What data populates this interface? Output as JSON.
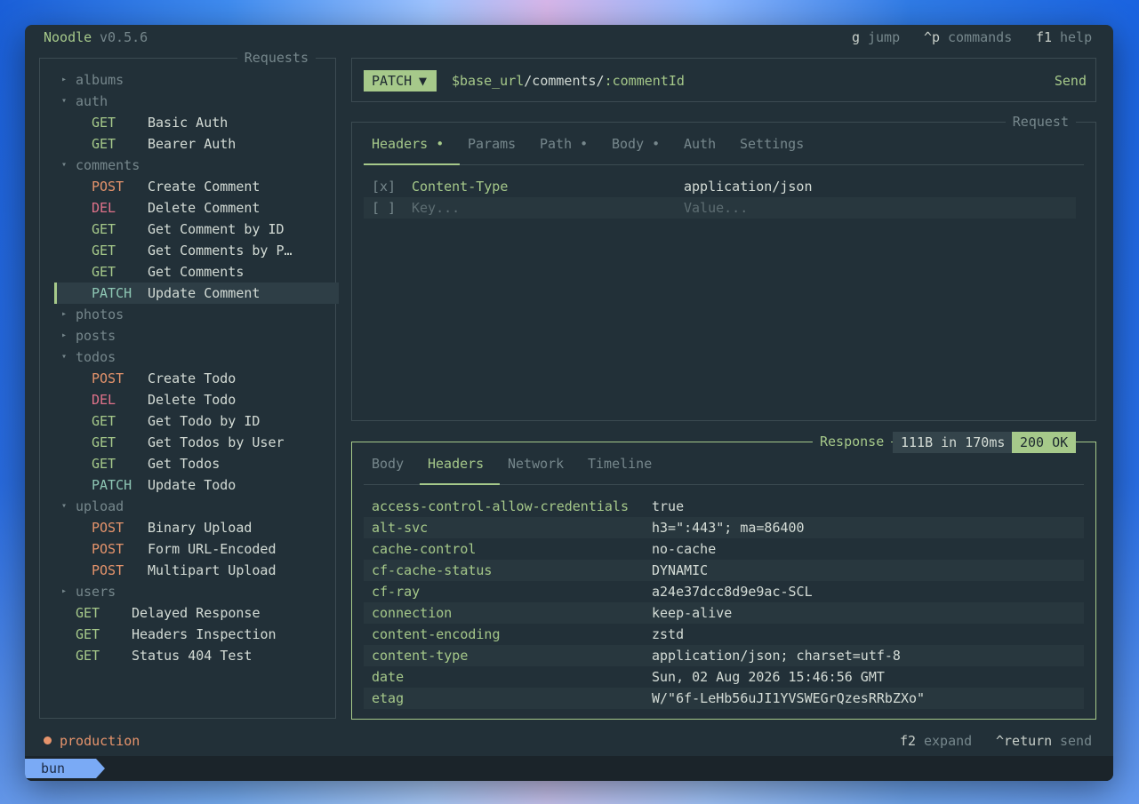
{
  "app": {
    "name": "Noodle",
    "version": "v0.5.6"
  },
  "shortcuts": [
    {
      "key": "g",
      "label": "jump"
    },
    {
      "key": "^p",
      "label": "commands"
    },
    {
      "key": "f1",
      "label": "help"
    }
  ],
  "sidebar": {
    "title": "Requests",
    "items": [
      {
        "type": "folder",
        "open": false,
        "name": "albums",
        "indent": 0
      },
      {
        "type": "folder",
        "open": true,
        "name": "auth",
        "indent": 0
      },
      {
        "type": "request",
        "method": "GET",
        "name": "Basic Auth",
        "indent": 1
      },
      {
        "type": "request",
        "method": "GET",
        "name": "Bearer Auth",
        "indent": 1
      },
      {
        "type": "folder",
        "open": true,
        "name": "comments",
        "indent": 0
      },
      {
        "type": "request",
        "method": "POST",
        "name": "Create Comment",
        "indent": 1
      },
      {
        "type": "request",
        "method": "DEL",
        "name": "Delete Comment",
        "indent": 1
      },
      {
        "type": "request",
        "method": "GET",
        "name": "Get Comment by ID",
        "indent": 1
      },
      {
        "type": "request",
        "method": "GET",
        "name": "Get Comments by P…",
        "indent": 1
      },
      {
        "type": "request",
        "method": "GET",
        "name": "Get Comments",
        "indent": 1
      },
      {
        "type": "request",
        "method": "PATCH",
        "name": "Update Comment",
        "indent": 1,
        "selected": true
      },
      {
        "type": "folder",
        "open": false,
        "name": "photos",
        "indent": 0
      },
      {
        "type": "folder",
        "open": false,
        "name": "posts",
        "indent": 0
      },
      {
        "type": "folder",
        "open": true,
        "name": "todos",
        "indent": 0
      },
      {
        "type": "request",
        "method": "POST",
        "name": "Create Todo",
        "indent": 1
      },
      {
        "type": "request",
        "method": "DEL",
        "name": "Delete Todo",
        "indent": 1
      },
      {
        "type": "request",
        "method": "GET",
        "name": "Get Todo by ID",
        "indent": 1
      },
      {
        "type": "request",
        "method": "GET",
        "name": "Get Todos by User",
        "indent": 1
      },
      {
        "type": "request",
        "method": "GET",
        "name": "Get Todos",
        "indent": 1
      },
      {
        "type": "request",
        "method": "PATCH",
        "name": "Update Todo",
        "indent": 1
      },
      {
        "type": "folder",
        "open": true,
        "name": "upload",
        "indent": 0
      },
      {
        "type": "request",
        "method": "POST",
        "name": "Binary Upload",
        "indent": 1
      },
      {
        "type": "request",
        "method": "POST",
        "name": "Form URL-Encoded",
        "indent": 1
      },
      {
        "type": "request",
        "method": "POST",
        "name": "Multipart Upload",
        "indent": 1
      },
      {
        "type": "folder",
        "open": false,
        "name": "users",
        "indent": 0
      },
      {
        "type": "request",
        "method": "GET",
        "name": "Delayed Response",
        "indent": 0
      },
      {
        "type": "request",
        "method": "GET",
        "name": "Headers Inspection",
        "indent": 0
      },
      {
        "type": "request",
        "method": "GET",
        "name": "Status 404 Test",
        "indent": 0
      }
    ]
  },
  "urlbar": {
    "method": "PATCH",
    "chevron": "▼",
    "url_var": "$base_url",
    "url_path": "/comments/",
    "url_param": ":commentId",
    "send_label": "Send"
  },
  "request_panel": {
    "title": "Request",
    "tabs": [
      "Headers •",
      "Params",
      "Path •",
      "Body •",
      "Auth",
      "Settings"
    ],
    "active_tab": "Headers •",
    "headers": [
      {
        "check": "[x]",
        "key": "Content-Type",
        "value": "application/json"
      }
    ],
    "new_row": {
      "check": "[ ]",
      "key_placeholder": "Key...",
      "value_placeholder": "Value..."
    }
  },
  "response_panel": {
    "title": "Response",
    "size_time": "111B in 170ms",
    "status": "200 OK",
    "tabs": [
      "Body",
      "Headers",
      "Network",
      "Timeline"
    ],
    "active_tab": "Headers",
    "headers": [
      {
        "key": "access-control-allow-credentials",
        "value": "true"
      },
      {
        "key": "alt-svc",
        "value": "h3=\":443\"; ma=86400"
      },
      {
        "key": "cache-control",
        "value": "no-cache"
      },
      {
        "key": "cf-cache-status",
        "value": "DYNAMIC"
      },
      {
        "key": "cf-ray",
        "value": "a24e37dcc8d9e9ac-SCL"
      },
      {
        "key": "connection",
        "value": "keep-alive"
      },
      {
        "key": "content-encoding",
        "value": "zstd"
      },
      {
        "key": "content-type",
        "value": "application/json; charset=utf-8"
      },
      {
        "key": "date",
        "value": "Sun, 02 Aug 2026 15:46:56 GMT"
      },
      {
        "key": "etag",
        "value": "W/\"6f-LeHb56uJI1YVSWEGrQzesRRbZXo\""
      }
    ]
  },
  "footer": {
    "environment": "production",
    "hints": [
      {
        "key": "f2",
        "label": "expand"
      },
      {
        "key": "^return",
        "label": "send"
      }
    ]
  },
  "taskbar": {
    "session": "bun",
    "add_label": "+"
  },
  "colors": {
    "accent": "#a6c98a",
    "get": "#a6c98a",
    "post": "#e6946c",
    "del": "#e0728a",
    "patch": "#8ec7b4",
    "background": "#223038"
  }
}
